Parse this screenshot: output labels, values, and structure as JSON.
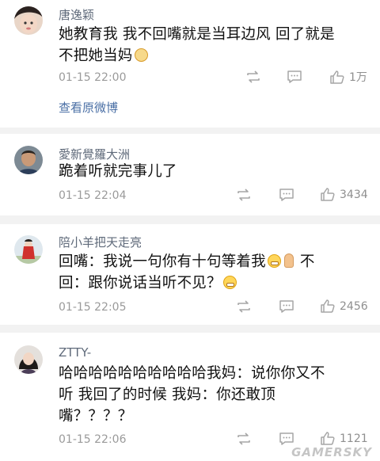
{
  "comments": [
    {
      "username": "唐逸颖",
      "text_line1": "她教育我 我不回嘴就是当耳边风 回了就是",
      "text_line2": "不把她当妈",
      "time": "01-15 22:00",
      "likes": "1万",
      "link": "查看原微博"
    },
    {
      "username": "愛新覺羅大洲",
      "text_line1": "跪着听就完事儿了",
      "time": "01-15 22:04",
      "likes": "3434"
    },
    {
      "username": "陪小羊把天走亮",
      "text_a": "回嘴：我说一句你有十句等着我",
      "text_b": "不",
      "text_c": "回：跟你说话当听不见？",
      "time": "01-15 22:05",
      "likes": "2456"
    },
    {
      "username": "ZTTY-",
      "text_line1": "哈哈哈哈哈哈哈哈哈哈我妈：说你你又不",
      "text_line2": "听 我回了的时候 我妈：你还敢顶",
      "text_line3": "嘴？？？？",
      "time": "01-15 22:06",
      "likes": "1121"
    }
  ],
  "watermark": "GAMERSKY",
  "icons": [
    "repost-icon",
    "comment-icon",
    "like-icon"
  ]
}
